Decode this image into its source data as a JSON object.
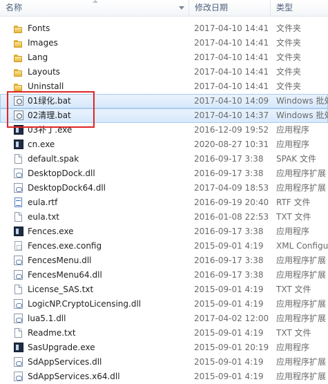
{
  "columns": {
    "name": "名称",
    "date": "修改日期",
    "type": "类型"
  },
  "files": [
    {
      "name": "Fonts",
      "date": "2017-04-10 14:41",
      "type": "文件夹",
      "icon": "folder-icon"
    },
    {
      "name": "Images",
      "date": "2017-04-10 14:41",
      "type": "文件夹",
      "icon": "folder-icon"
    },
    {
      "name": "Lang",
      "date": "2017-04-10 14:41",
      "type": "文件夹",
      "icon": "folder-icon"
    },
    {
      "name": "Layouts",
      "date": "2017-04-10 14:41",
      "type": "文件夹",
      "icon": "folder-icon"
    },
    {
      "name": "Uninstall",
      "date": "2017-04-10 14:41",
      "type": "文件夹",
      "icon": "folder-icon"
    },
    {
      "name": "01绿化.bat",
      "date": "2017-04-10 14:09",
      "type": "Windows 批处",
      "icon": "batch-file-icon",
      "selected": true
    },
    {
      "name": "02清理.bat",
      "date": "2017-04-10 14:37",
      "type": "Windows 批处",
      "icon": "batch-file-icon",
      "selected": true
    },
    {
      "name": "03补丁.exe",
      "date": "2016-12-09 19:52",
      "type": "应用程序",
      "icon": "exe-icon"
    },
    {
      "name": "cn.exe",
      "date": "2020-08-27 10:31",
      "type": "应用程序",
      "icon": "exe-icon"
    },
    {
      "name": "default.spak",
      "date": "2016-09-17 3:38",
      "type": "SPAK 文件",
      "icon": "file-icon"
    },
    {
      "name": "DesktopDock.dll",
      "date": "2016-09-17 3:38",
      "type": "应用程序扩展",
      "icon": "dll-icon"
    },
    {
      "name": "DesktopDock64.dll",
      "date": "2017-04-09 18:53",
      "type": "应用程序扩展",
      "icon": "dll-icon"
    },
    {
      "name": "eula.rtf",
      "date": "2016-09-19 20:40",
      "type": "RTF 文件",
      "icon": "rtf-icon"
    },
    {
      "name": "eula.txt",
      "date": "2016-01-08 22:53",
      "type": "TXT 文件",
      "icon": "file-icon"
    },
    {
      "name": "Fences.exe",
      "date": "2016-09-17 3:38",
      "type": "应用程序",
      "icon": "exe-icon"
    },
    {
      "name": "Fences.exe.config",
      "date": "2015-09-01 4:19",
      "type": "XML Configu",
      "icon": "config-icon"
    },
    {
      "name": "FencesMenu.dll",
      "date": "2016-09-17 3:38",
      "type": "应用程序扩展",
      "icon": "dll-icon"
    },
    {
      "name": "FencesMenu64.dll",
      "date": "2016-09-17 3:38",
      "type": "应用程序扩展",
      "icon": "dll-icon"
    },
    {
      "name": "License_SAS.txt",
      "date": "2015-09-01 4:19",
      "type": "TXT 文件",
      "icon": "file-icon"
    },
    {
      "name": "LogicNP.CryptoLicensing.dll",
      "date": "2015-09-01 4:19",
      "type": "应用程序扩展",
      "icon": "dll-icon"
    },
    {
      "name": "lua5.1.dll",
      "date": "2017-04-02 12:00",
      "type": "应用程序扩展",
      "icon": "dll-icon"
    },
    {
      "name": "Readme.txt",
      "date": "2015-09-01 4:19",
      "type": "TXT 文件",
      "icon": "file-icon"
    },
    {
      "name": "SasUpgrade.exe",
      "date": "2015-09-01 20:19",
      "type": "应用程序",
      "icon": "exe-icon"
    },
    {
      "name": "SdAppServices.dll",
      "date": "2015-09-01 4:19",
      "type": "应用程序扩展",
      "icon": "dll-icon"
    },
    {
      "name": "SdAppServices.x64.dll",
      "date": "2015-09-01 4:19",
      "type": "应用程序扩展",
      "icon": "dll-icon"
    }
  ],
  "colors": {
    "selection": "#d6e8fb",
    "highlight_border": "#e02424",
    "folder": "#e7b73a"
  }
}
